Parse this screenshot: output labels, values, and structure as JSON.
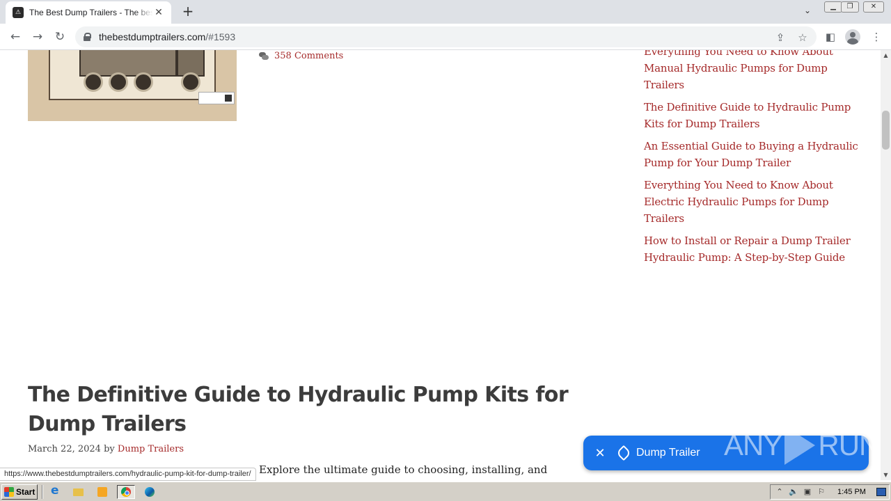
{
  "browser": {
    "tab_title": "The Best Dump Trailers - The best du",
    "new_tab_symbol": "+",
    "url_host": "thebestdumptrailers.com",
    "url_rest": "/#1593"
  },
  "post": {
    "comments": "358 Comments"
  },
  "sidebar": {
    "links": [
      "Everything You Need to Know About Manual Hydraulic Pumps for Dump Trailers",
      "The Definitive Guide to Hydraulic Pump Kits for Dump Trailers",
      "An Essential Guide to Buying a Hydraulic Pump for Your Dump Trailer",
      "Everything You Need to Know About Electric Hydraulic Pumps for Dump Trailers",
      "How to Install or Repair a Dump Trailer Hydraulic Pump: A Step-by-Step Guide"
    ]
  },
  "article": {
    "title": "The Definitive Guide to Hydraulic Pump Kits for Dump Trailers",
    "date": "March 22, 2024",
    "by": "by",
    "author": "Dump Trailers",
    "excerpt": "Explore the ultimate guide to choosing, installing, and"
  },
  "status_url": "https://www.thebestdumptrailers.com/hydraulic-pump-kit-for-dump-trailer/",
  "chip": {
    "label": "Dump Trailer",
    "color": "#1a73e8"
  },
  "watermark": {
    "left": "ANY",
    "right": "RUN"
  },
  "taskbar": {
    "start_label": "Start",
    "clock": "1:45 PM"
  },
  "colors": {
    "link": "#a52a2a",
    "title": "#3c3c3c"
  }
}
